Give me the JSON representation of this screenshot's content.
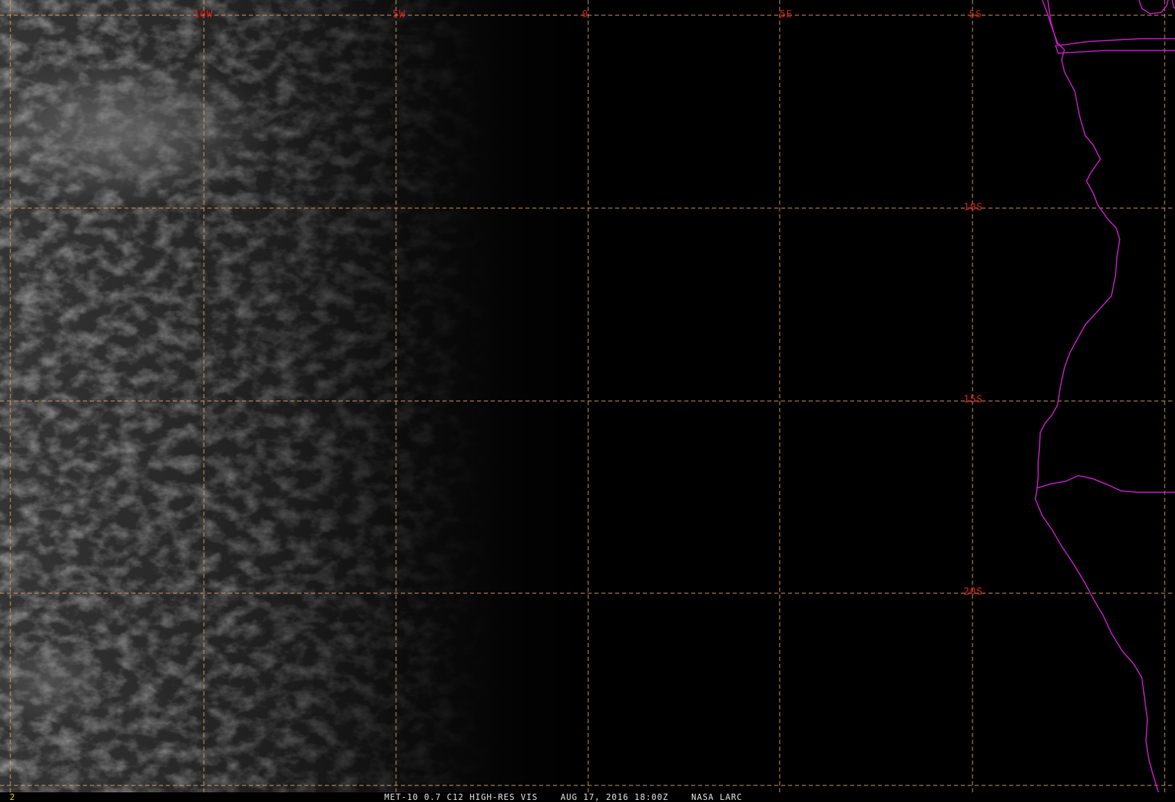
{
  "colors": {
    "grid": "#e0a060",
    "grid_label": "#e0201a",
    "coastline": "#d21ed2",
    "frame_number": "#e8d800"
  },
  "map": {
    "longitude_labels": [
      "10W",
      "5W",
      "0",
      "5E"
    ],
    "latitude_labels": [
      "5S",
      "10S",
      "15S",
      "20S"
    ]
  },
  "footer": {
    "frame_number": "2",
    "caption": "MET-10 0.7 C12 HIGH-RES VIS    AUG 17, 2016 18:00Z    NASA LARC"
  }
}
